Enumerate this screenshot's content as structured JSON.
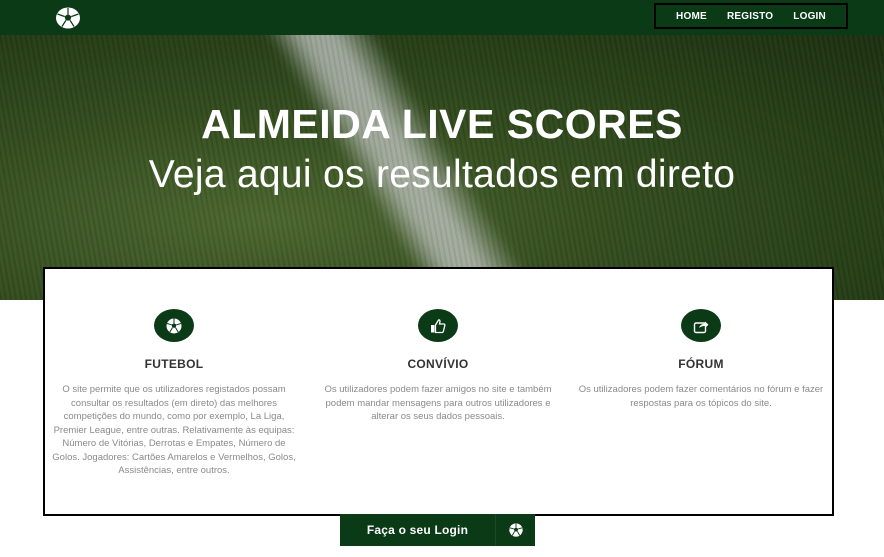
{
  "nav": {
    "items": [
      "HOME",
      "REGISTO",
      "LOGIN"
    ]
  },
  "hero": {
    "title": "ALMEIDA LIVE SCORES",
    "subtitle": "Veja aqui os resultados em direto"
  },
  "features": [
    {
      "icon": "soccer-ball-icon",
      "title": "FUTEBOL",
      "text": "O site permite que os utilizadores registados possam consultar os resultados (em direto) das melhores competições do mundo, como por exemplo, La Liga, Premier League, entre outras. Relativamente às equipas: Número de Vitórias, Derrotas e Empates, Número de Golos. Jogadores: Cartões Amarelos e Vermelhos, Golos, Assistências, entre outros."
    },
    {
      "icon": "thumbs-up-icon",
      "title": "CONVÍVIO",
      "text": "Os utilizadores podem fazer amigos no site e também podem mandar mensagens para outros utilizadores e alterar os seus dados pessoais."
    },
    {
      "icon": "share-icon",
      "title": "FÓRUM",
      "text": "Os utilizadores podem fazer comentários no fórum e fazer respostas para os tópicos do site."
    }
  ],
  "cta": {
    "label": "Faça o seu Login",
    "icon": "soccer-ball-icon"
  },
  "colors": {
    "brand": "#0b3a17",
    "text_muted": "#8a8a8a"
  }
}
